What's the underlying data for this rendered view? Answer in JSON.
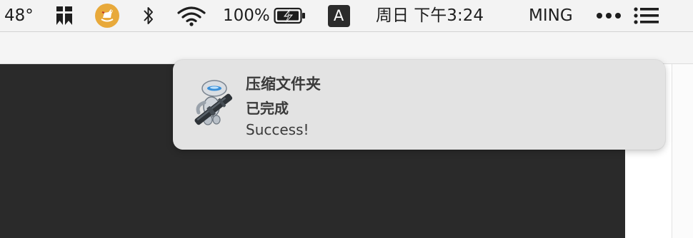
{
  "menubar": {
    "temperature": "48°",
    "battery_percent": "100%",
    "input_source": "A",
    "datetime": "周日 下午3:24",
    "user": "MING",
    "icons": {
      "bookmark": "bookmark-icon",
      "rocking_horse": "rocking-horse-icon",
      "bluetooth": "bluetooth-icon",
      "wifi": "wifi-icon",
      "battery": "battery-charging-icon",
      "more": "more-dots-icon",
      "list": "notification-center-icon"
    },
    "accent_colors": {
      "rocking_horse_badge": "#e8a93a"
    }
  },
  "notification": {
    "title": "压缩文件夹",
    "subtitle": "已完成",
    "body": "Success!",
    "icon": "automator-robot-icon"
  }
}
